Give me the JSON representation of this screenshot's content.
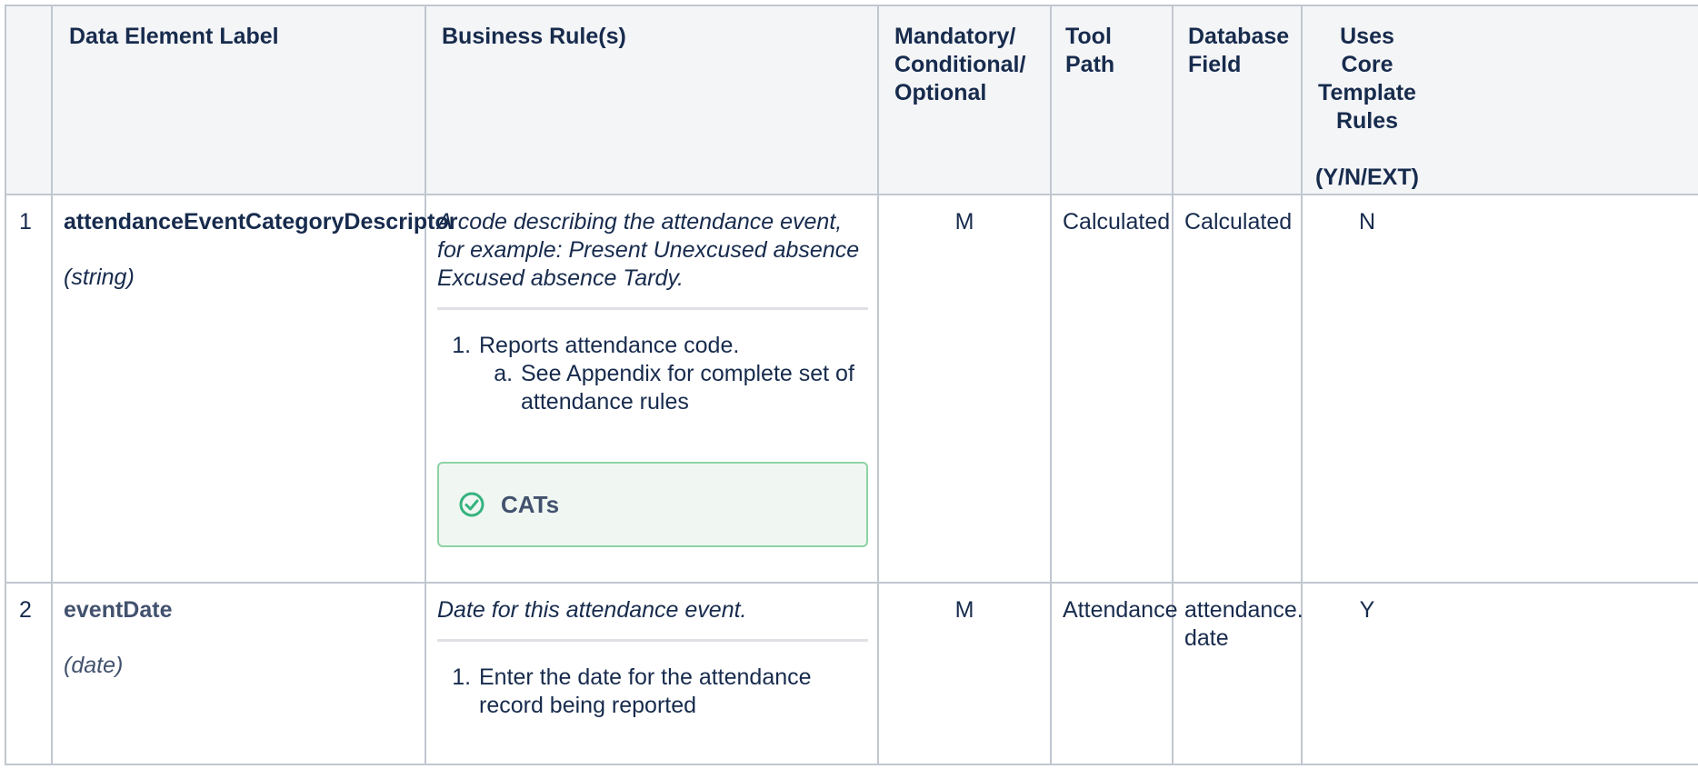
{
  "headers": {
    "num": "",
    "label": "Data Element Label",
    "rules": "Business Rule(s)",
    "mco": [
      "Mandatory/",
      "Conditional/",
      "Optional"
    ],
    "tool": [
      "Tool",
      "Path"
    ],
    "db": [
      "Database",
      "Field"
    ],
    "core": [
      "Uses",
      "Core",
      "Template",
      "Rules",
      "(Y/N/EXT)"
    ]
  },
  "rows": [
    {
      "num": "1",
      "label": "attendanceEventCategoryDescriptor",
      "type": "(string)",
      "description": "A code describing the attendance event, for example: Present Unexcused absence Excused absence Tardy.",
      "rule_1": "Reports attendance code.",
      "rule_1a": "See Appendix for complete set of attendance rules",
      "panel_title": "CATs",
      "mco": "M",
      "tool_path": "Calculated",
      "db_field": "Calculated",
      "core": "N"
    },
    {
      "num": "2",
      "label": "eventDate",
      "type": "(date)",
      "description": "Date for this attendance event.",
      "rule_1": "Enter the date for the attendance record being reported",
      "mco": "M",
      "tool_path": "Attendance",
      "db_field": [
        "attendance.",
        "date"
      ],
      "core": "Y"
    }
  ],
  "colors": {
    "border": "#c1c7d0",
    "header_bg": "#f4f5f7",
    "panel_bg": "#f0f7f2",
    "panel_border": "#8dd3a4",
    "success_icon": "#36b37e"
  },
  "icons": {
    "panel": "check-circle-icon"
  }
}
